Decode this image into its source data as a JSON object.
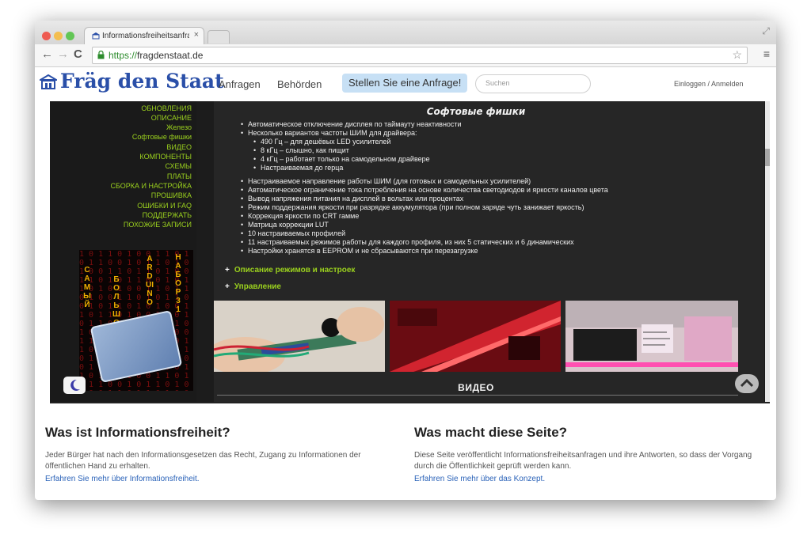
{
  "browser": {
    "tab_title": "Informationsfreiheitsanfrage",
    "url_scheme": "https://",
    "url_host": "fragdenstaat.de"
  },
  "site": {
    "logo": "Fräg den Staat",
    "nav": [
      "Anfragen",
      "Behörden"
    ],
    "cta": "Stellen Sie eine Anfrage!",
    "search_placeholder": "Suchen",
    "login": "Einloggen / Anmelden"
  },
  "embedded": {
    "sidebar_links": [
      "ОБНОВЛЕНИЯ",
      "ОПИСАНИЕ",
      "Железо",
      "Софтовые фишки",
      "ВИДЕО",
      "КОМПОНЕНТЫ",
      "СХЕМЫ",
      "ПЛАТЫ",
      "СБОРКА И НАСТРОЙКА",
      "ПРОШИВКА",
      "ОШИБКИ И FAQ",
      "ПОДДЕРЖАТЬ",
      "ПОХОЖИЕ ЗАПИСИ"
    ],
    "promo": {
      "col1": "САМЫЙ",
      "col2": "БОЛЬШОЙ",
      "col3": "ARDUINO",
      "col4": "НАБОР31"
    },
    "heading": "Софтовые фишки",
    "bullets": [
      "Автоматическое отключение дисплея по таймауту неактивности",
      "Несколько вариантов частоты ШИМ для драйвера:",
      "490 Гц – для дешёвых LED усилителей",
      "8 кГц – слышно, как пищит",
      "4 кГц – работает только на самодельном драйвере",
      "Настраиваемая до герца",
      "Настраиваемое направление работы ШИМ (для готовых и самодельных усилителей)",
      "Автоматическое ограничение тока потребления на основе количества светодиодов и яркости каналов цвета",
      "Вывод напряжения питания на дисплей в вольтах или процентах",
      "Режим поддержания яркости при разрядке аккумулятора (при полном заряде чуть занижает яркость)",
      "Коррекция яркости по CRT гамме",
      "Матрица коррекции LUT",
      "10 настраиваемых профилей",
      "11 настраиваемых режимов работы для каждого профиля, из них 5 статических и 6 динамических",
      "Настройки хранятся в EEPROM и не сбрасываются при перезагрузке"
    ],
    "accordion": [
      "Описание режимов и настроек",
      "Управление"
    ],
    "video_heading": "ВИДЕО"
  },
  "footer": {
    "left": {
      "title": "Was ist Informationsfreiheit?",
      "text": "Jeder Bürger hat nach den Informationsgesetzen das Recht, Zugang zu Informationen der öffentlichen Hand zu erhalten.",
      "link": "Erfahren Sie mehr über Informationsfreiheit."
    },
    "right": {
      "title": "Was macht diese Seite?",
      "text": "Diese Seite veröffentlicht Informationsfreiheitsanfragen und ihre Antworten, so dass der Vorgang durch die Öffentlichkeit geprüft werden kann.",
      "link": "Erfahren Sie mehr über das Konzept."
    }
  },
  "colors": {
    "accent_green": "#9bd11e",
    "link_blue": "#2a62b8",
    "logo_blue": "#2a4fa8"
  }
}
